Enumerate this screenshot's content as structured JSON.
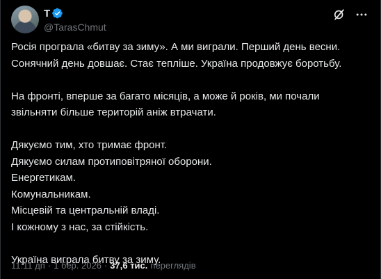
{
  "context": {
    "text": "Оригінальний пост (ч/б, ранок)"
  },
  "author": {
    "display_name": "T",
    "handle": "@TarasChmut",
    "verified": true
  },
  "tweet": {
    "text": "Росія програла «битву за зиму». А ми виграли. Перший день весни.\nСонячний день довшає. Стає тепліше. Україна продовжує боротьбу.\n\nНа фронті, вперше за багато місяців, а може й років, ми почали\nзвільняти більше територій аніж втрачати.\n\nДякуємо тим, хто тримає фронт.\nДякуємо силам протиповітряної оборони.\nЕнергетикам.\nКомунальникам.\nМісцевій та центральній владі.\nІ кожному з нас, за стійкість.\n\nУкраїна виграла битву за зиму."
  },
  "meta": {
    "time": "11:11 дп",
    "date": "1 бер. 2026",
    "separator": "·",
    "views_count": "37,6 тис.",
    "views_label": "переглядів"
  },
  "icons": {
    "avatar": "user-avatar",
    "verified": "verified-badge-icon",
    "grok": "grok-icon",
    "more": "more-icon"
  },
  "colors": {
    "background": "#000000",
    "text": "#e7e9ea",
    "secondary": "#71767b",
    "verified": "#1d9bf0"
  }
}
